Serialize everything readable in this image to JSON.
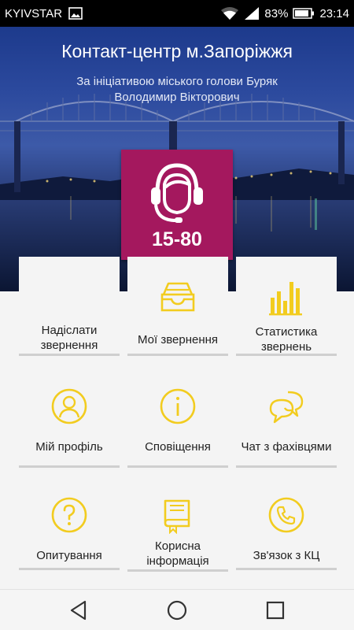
{
  "status_bar": {
    "carrier": "KYIVSTAR",
    "battery": "83%",
    "time": "23:14",
    "icons": [
      "image-icon",
      "wifi-icon",
      "signal-icon",
      "battery-icon"
    ]
  },
  "header": {
    "title": "Контакт-центр м.Запоріжжя",
    "subtitle_line1": "За ініціативою міського голови Буряк",
    "subtitle_line2": "Володимир Вікторович"
  },
  "hotline": {
    "number": "15-80",
    "icon": "operator-headset-icon"
  },
  "menu": [
    {
      "label_line1": "Надіслати",
      "label_line2": "звернення",
      "icon": "message-icon"
    },
    {
      "label_line1": "Мої звернення",
      "label_line2": "",
      "icon": "inbox-icon"
    },
    {
      "label_line1": "Статистика",
      "label_line2": "звернень",
      "icon": "bar-chart-icon"
    },
    {
      "label_line1": "Мій профіль",
      "label_line2": "",
      "icon": "profile-icon"
    },
    {
      "label_line1": "Сповіщення",
      "label_line2": "",
      "icon": "info-icon"
    },
    {
      "label_line1": "Чат з фахівцями",
      "label_line2": "",
      "icon": "chat-icon"
    },
    {
      "label_line1": "Опитування",
      "label_line2": "",
      "icon": "question-icon"
    },
    {
      "label_line1": "Корисна",
      "label_line2": "інформація",
      "icon": "book-icon"
    },
    {
      "label_line1": "Зв'язок з КЦ",
      "label_line2": "",
      "icon": "phone-icon"
    }
  ],
  "colors": {
    "accent_yellow": "#f2cc1f",
    "hotline_magenta": "#a4185e",
    "hero_blue": "#2c4a9e"
  },
  "navigation": {
    "buttons": [
      "back-icon",
      "home-icon",
      "recents-icon"
    ]
  }
}
